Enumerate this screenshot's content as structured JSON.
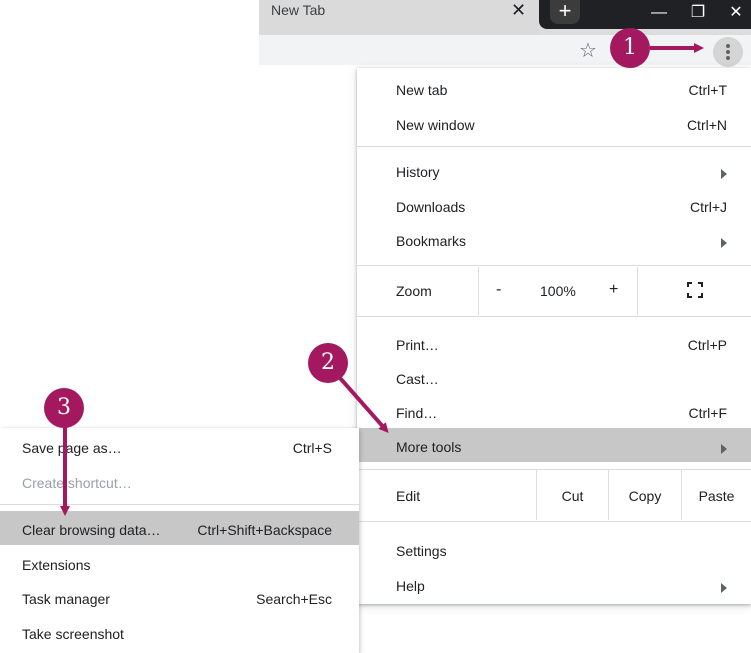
{
  "tab": {
    "title": "New Tab",
    "close": "✕"
  },
  "window": {
    "new_tab": "+",
    "minimize": "—",
    "restore": "❐",
    "close": "✕"
  },
  "toolbar": {
    "star": "☆"
  },
  "menu": {
    "new_tab": {
      "label": "New tab",
      "shortcut": "Ctrl+T"
    },
    "new_window": {
      "label": "New window",
      "shortcut": "Ctrl+N"
    },
    "history": {
      "label": "History"
    },
    "downloads": {
      "label": "Downloads",
      "shortcut": "Ctrl+J"
    },
    "bookmarks": {
      "label": "Bookmarks"
    },
    "zoom": {
      "label": "Zoom",
      "minus": "-",
      "value": "100%",
      "plus": "+"
    },
    "print": {
      "label": "Print…",
      "shortcut": "Ctrl+P"
    },
    "cast": {
      "label": "Cast…"
    },
    "find": {
      "label": "Find…",
      "shortcut": "Ctrl+F"
    },
    "more_tools": {
      "label": "More tools"
    },
    "edit": {
      "label": "Edit",
      "cut": "Cut",
      "copy": "Copy",
      "paste": "Paste"
    },
    "settings": {
      "label": "Settings"
    },
    "help": {
      "label": "Help"
    }
  },
  "submenu": {
    "save_page": {
      "label": "Save page as…",
      "shortcut": "Ctrl+S"
    },
    "create_shortcut": {
      "label": "Create shortcut…"
    },
    "clear_browsing": {
      "label": "Clear browsing data…",
      "shortcut": "Ctrl+Shift+Backspace"
    },
    "extensions": {
      "label": "Extensions"
    },
    "task_manager": {
      "label": "Task manager",
      "shortcut": "Search+Esc"
    },
    "take_screenshot": {
      "label": "Take screenshot"
    }
  },
  "markers": {
    "one": "1",
    "two": "2",
    "three": "3"
  },
  "colors": {
    "accent": "#a3185f",
    "highlight": "#c7c7c7"
  }
}
